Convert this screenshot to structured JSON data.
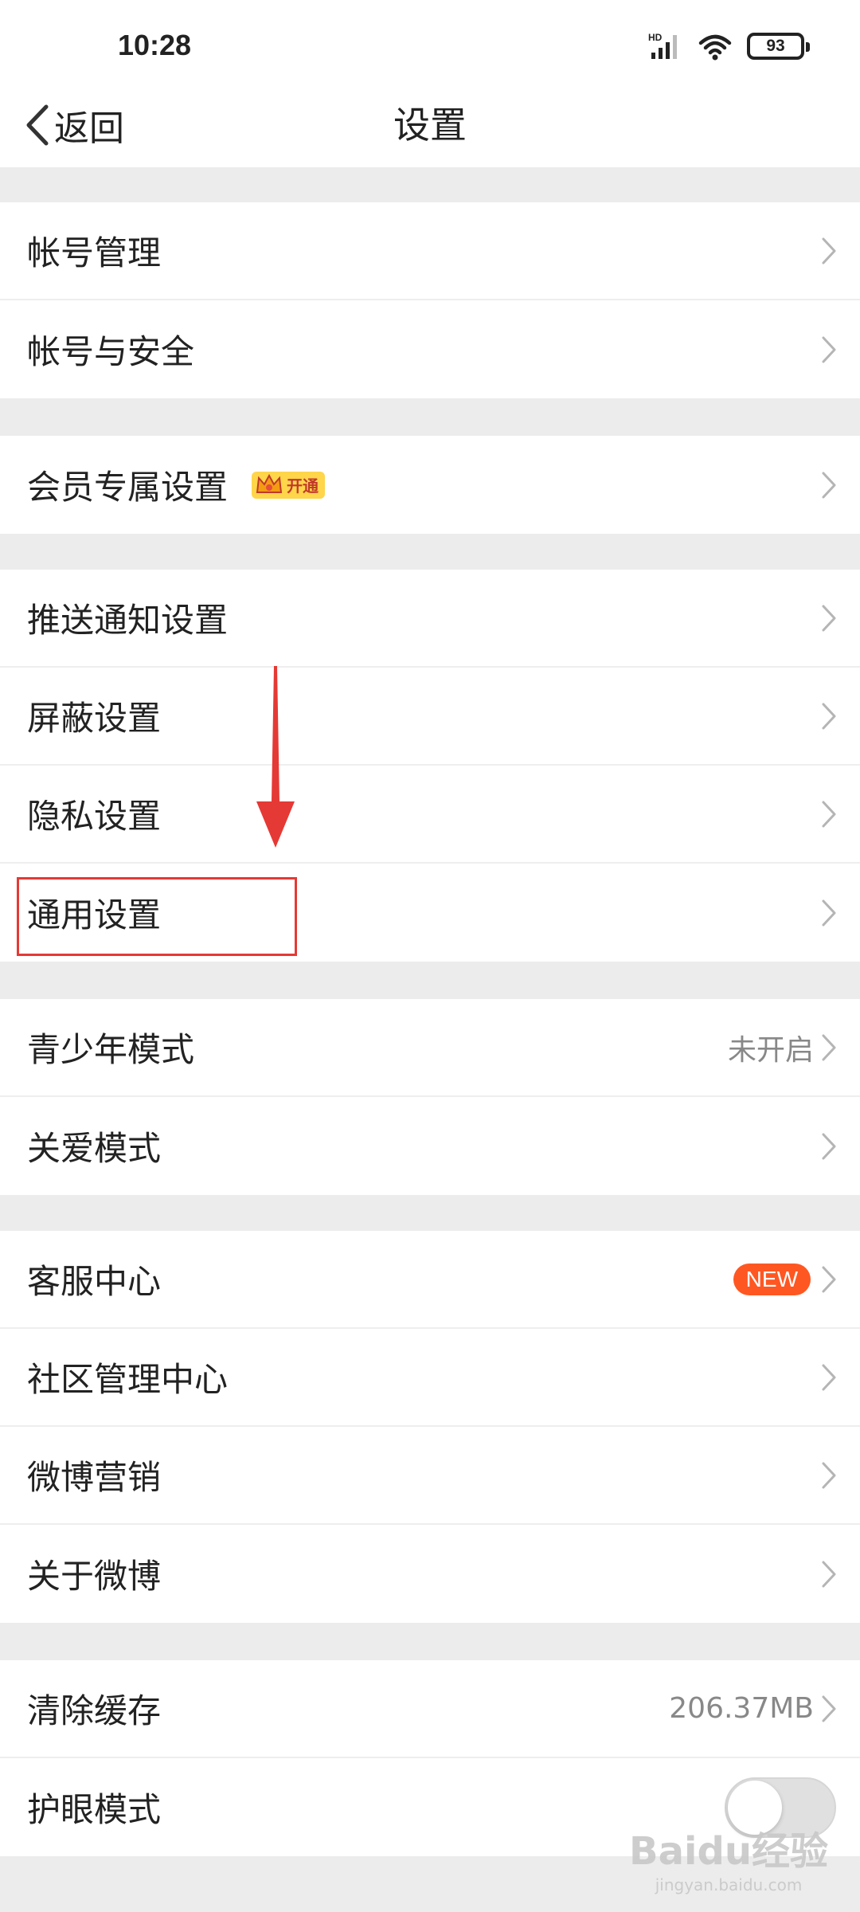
{
  "status_bar": {
    "time": "10:28",
    "network_label": "HD",
    "battery": "93"
  },
  "nav": {
    "back_label": "返回",
    "title": "设置"
  },
  "groups": [
    {
      "items": [
        {
          "label": "帐号管理"
        },
        {
          "label": "帐号与安全"
        }
      ]
    },
    {
      "items": [
        {
          "label": "会员专属设置",
          "badge": "开通"
        }
      ]
    },
    {
      "items": [
        {
          "label": "推送通知设置"
        },
        {
          "label": "屏蔽设置"
        },
        {
          "label": "隐私设置"
        },
        {
          "label": "通用设置"
        }
      ]
    },
    {
      "items": [
        {
          "label": "青少年模式",
          "value": "未开启"
        },
        {
          "label": "关爱模式"
        }
      ]
    },
    {
      "items": [
        {
          "label": "客服中心",
          "badge": "NEW"
        },
        {
          "label": "社区管理中心"
        },
        {
          "label": "微博营销"
        },
        {
          "label": "关于微博"
        }
      ]
    },
    {
      "items": [
        {
          "label": "清除缓存",
          "value": "206.37MB"
        },
        {
          "label": "护眼模式",
          "toggle": false
        }
      ]
    }
  ],
  "watermark": {
    "main": "Baidu经验",
    "sub": "jingyan.baidu.com"
  },
  "colors": {
    "accent_red": "#e53935",
    "new_badge": "#ff5722",
    "vip_badge": "#ffd54a"
  }
}
